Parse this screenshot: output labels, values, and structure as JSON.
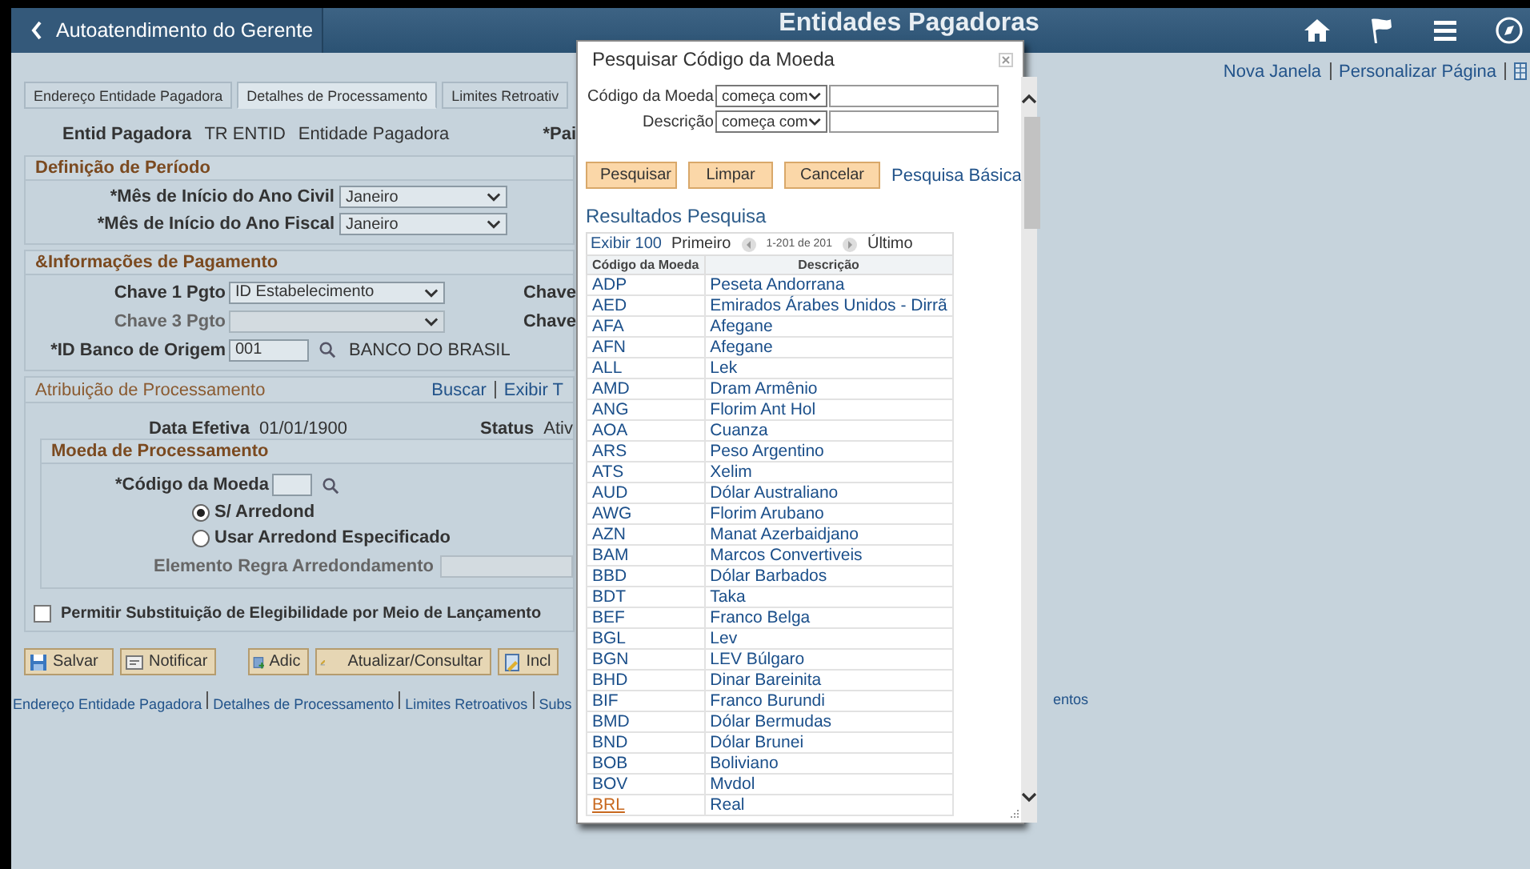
{
  "header": {
    "back_label": "Autoatendimento do Gerente",
    "title": "Entidades Pagadoras"
  },
  "top_links": [
    "Nova Janela",
    "Personalizar Página"
  ],
  "tabs": [
    {
      "label": "Endereço Entidade Pagadora",
      "selected": false
    },
    {
      "label": "Detalhes de Processamento",
      "selected": true
    },
    {
      "label": "Limites Retroativ",
      "selected": false
    }
  ],
  "entity": {
    "label": "Entid Pagadora",
    "code": "TR ENTID",
    "name": "Entidade Pagadora",
    "right_label": "*Pai"
  },
  "period_section": {
    "title": "Definição de Período",
    "fields": [
      {
        "label": "*Mês de Início do Ano Civil",
        "value": "Janeiro"
      },
      {
        "label": "*Mês de Início do Ano Fiscal",
        "value": "Janeiro"
      }
    ]
  },
  "payment_section": {
    "title": "&Informações de Pagamento",
    "rows": [
      {
        "label": "Chave 1 Pgto",
        "value": "ID Estabelecimento",
        "disabled": false,
        "right_label": "Chave"
      },
      {
        "label": "Chave 3 Pgto",
        "disabled": true,
        "right_label": "Chave"
      }
    ],
    "bank": {
      "label": "*ID Banco de Origem",
      "value": "001",
      "description": "BANCO DO BRASIL"
    }
  },
  "assignment_section": {
    "title": "Atribuição de Processamento",
    "links": [
      "Buscar",
      "Exibir T"
    ],
    "date_label": "Data Efetiva",
    "date_value": "01/01/1900",
    "status_label": "Status",
    "status_value": "Ativ",
    "currency": {
      "title": "Moeda de Processamento",
      "code_label": "*Código da Moeda",
      "rounding_options": [
        {
          "label": "S/ Arredond",
          "selected": true
        },
        {
          "label": "Usar Arredond Especificado",
          "selected": false
        }
      ],
      "rule_label": "Elemento Regra Arredondamento"
    },
    "override": {
      "label": "Permitir Substituição de Elegibilidade por Meio de Lançamento",
      "checked": false
    }
  },
  "buttons": [
    {
      "label": "Salvar",
      "kind": "save"
    },
    {
      "label": "Notificar",
      "kind": "notify"
    },
    {
      "label": "Adic",
      "kind": "add"
    },
    {
      "label": "Atualizar/Consultar",
      "kind": "edit"
    },
    {
      "label": "Incl",
      "kind": "insert"
    }
  ],
  "footer_links": [
    "Endereço Entidade Pagadora",
    "Detalhes de Processamento",
    "Limites Retroativos",
    "Subs"
  ],
  "footer_tail": "entos",
  "dialog": {
    "title": "Pesquisar Código da Moeda",
    "filters": [
      {
        "label": "Código da Moeda",
        "operator": "começa com"
      },
      {
        "label": "Descrição",
        "operator": "começa com"
      }
    ],
    "buttons": [
      "Pesquisar",
      "Limpar",
      "Cancelar"
    ],
    "basic_link": "Pesquisa Básica",
    "results_title": "Resultados Pesquisa",
    "pager": {
      "show": "Exibir 100",
      "first": "Primeiro",
      "range": "1-201 de 201",
      "last": "Último"
    },
    "columns": [
      "Código da Moeda",
      "Descrição"
    ],
    "rows": [
      {
        "code": "ADP",
        "description": "Peseta Andorrana",
        "highlighted": false
      },
      {
        "code": "AED",
        "description": "Emirados Árabes Unidos - Dirrã",
        "highlighted": false
      },
      {
        "code": "AFA",
        "description": "Afegane",
        "highlighted": false
      },
      {
        "code": "AFN",
        "description": "Afegane",
        "highlighted": false
      },
      {
        "code": "ALL",
        "description": "Lek",
        "highlighted": false
      },
      {
        "code": "AMD",
        "description": "Dram Armênio",
        "highlighted": false
      },
      {
        "code": "ANG",
        "description": "Florim Ant Hol",
        "highlighted": false
      },
      {
        "code": "AOA",
        "description": "Cuanza",
        "highlighted": false
      },
      {
        "code": "ARS",
        "description": "Peso Argentino",
        "highlighted": false
      },
      {
        "code": "ATS",
        "description": "Xelim",
        "highlighted": false
      },
      {
        "code": "AUD",
        "description": "Dólar Australiano",
        "highlighted": false
      },
      {
        "code": "AWG",
        "description": "Florim Arubano",
        "highlighted": false
      },
      {
        "code": "AZN",
        "description": "Manat Azerbaidjano",
        "highlighted": false
      },
      {
        "code": "BAM",
        "description": "Marcos Convertiveis",
        "highlighted": false
      },
      {
        "code": "BBD",
        "description": "Dólar Barbados",
        "highlighted": false
      },
      {
        "code": "BDT",
        "description": "Taka",
        "highlighted": false
      },
      {
        "code": "BEF",
        "description": "Franco Belga",
        "highlighted": false
      },
      {
        "code": "BGL",
        "description": "Lev",
        "highlighted": false
      },
      {
        "code": "BGN",
        "description": "LEV Búlgaro",
        "highlighted": false
      },
      {
        "code": "BHD",
        "description": "Dinar Bareinita",
        "highlighted": false
      },
      {
        "code": "BIF",
        "description": "Franco Burundi",
        "highlighted": false
      },
      {
        "code": "BMD",
        "description": "Dólar Bermudas",
        "highlighted": false
      },
      {
        "code": "BND",
        "description": "Dólar Brunei",
        "highlighted": false
      },
      {
        "code": "BOB",
        "description": "Boliviano",
        "highlighted": false
      },
      {
        "code": "BOV",
        "description": "Mvdol",
        "highlighted": false
      },
      {
        "code": "BRL",
        "description": "Real",
        "highlighted": true
      }
    ]
  }
}
